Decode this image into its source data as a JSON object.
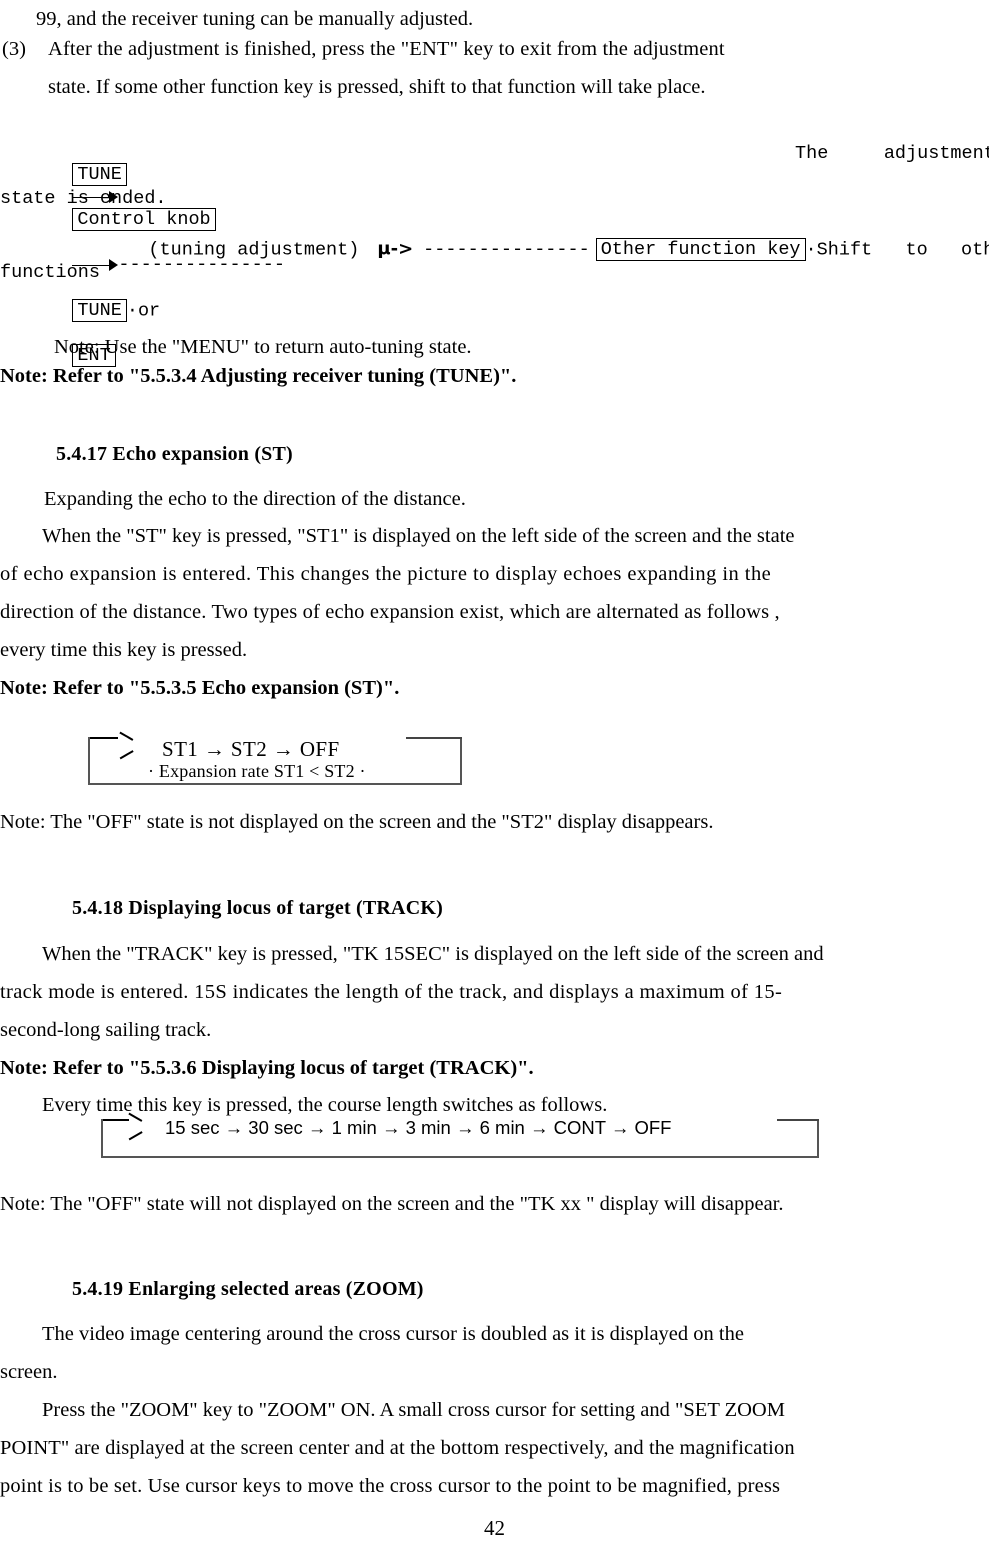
{
  "document": {
    "page_number": "42"
  },
  "intro": {
    "continued_line": "99, and the receiver tuning can be manually adjusted.",
    "item_marker": "(3)",
    "item_line1": "After  the  adjustment  is  finished,  press  the  \"ENT\"  key  to  exit  from  the  adjustment",
    "item_line2": "state.  If some other function key is pressed, shift to that function will take place."
  },
  "tune_diagram": {
    "key_tune": "TUNE",
    "box_control_knob": "Control knob",
    "dash_line": "---------------",
    "key_tune2": "TUNE",
    "or_label": "·or",
    "key_ent": "ENT",
    "trailing_text": "The     adjustment",
    "line2": "state is ended.",
    "tuning_adjustment_label": "(tuning adjustment)",
    "mu_arrow": "μ->",
    "dash_line2": "---------------",
    "box_other_function_key": "Other function key",
    "shift_text": "·Shift   to   other",
    "line4": "functions"
  },
  "tune_notes": {
    "menu_note": "Note: Use the \"MENU\" to return auto-tuning state.",
    "refer_note": "Note: Refer to \"5.5.3.4 Adjusting receiver tuning (TUNE)\"."
  },
  "section_st": {
    "heading": "5.4.17 Echo expansion (ST)",
    "para1": "Expanding the echo to the direction of the distance.",
    "para2_lines": [
      "When the \"ST\" key is pressed, \"ST1\" is displayed on the left side of the screen and the state",
      "of echo expansion is entered.  This changes the picture to display echoes expanding in the",
      "direction of the distance.  Two types of echo expansion exist, which are alternated as follows ,",
      "every time this key is pressed."
    ],
    "refer_note": "Note: Refer to \"5.5.3.5 Echo expansion (ST)\".",
    "sequence": "ST1  →   ST2   →   OFF",
    "sequence_sub": "· Expansion rate ST1 < ST2  ·",
    "off_note": "Note: The \"OFF\" state is not displayed on the screen and the \"ST2\" display disappears."
  },
  "section_track": {
    "heading": "5.4.18 Displaying locus of target (TRACK)",
    "para_lines": [
      "When the \"TRACK\" key is pressed, \"TK 15SEC\" is displayed on the left side of the screen and",
      "track mode is entered.  15S indicates the length of the track, and displays a maximum of 15-",
      "second-long sailing track."
    ],
    "refer_note": "Note: Refer to \"5.5.3.6 Displaying locus of target (TRACK)\".",
    "every_time_line": "Every time this key is pressed, the course length switches as follows.",
    "sequence": "15 sec  →  30 sec → 1 min → 3 min → 6  min → CONT → OFF",
    "off_note": "Note: The \"OFF\" state will not displayed on the screen and the \"TK xx \" display will disappear."
  },
  "section_zoom": {
    "heading": "5.4.19 Enlarging selected areas (ZOOM)",
    "para1_lines": [
      "The  video  image  centering  around  the  cross  cursor  is  doubled  as  it  is  displayed  on  the",
      "screen."
    ],
    "para2_lines": [
      "Press  the  \"ZOOM\"  key  to  \"ZOOM\"  ON.  A  small  cross  cursor  for  setting  and  \"SET  ZOOM",
      "POINT\" are displayed at the screen center and at the bottom respectively, and the magnification",
      "point is to be set.  Use cursor keys to move the cross cursor to the point to be magnified, press"
    ]
  }
}
